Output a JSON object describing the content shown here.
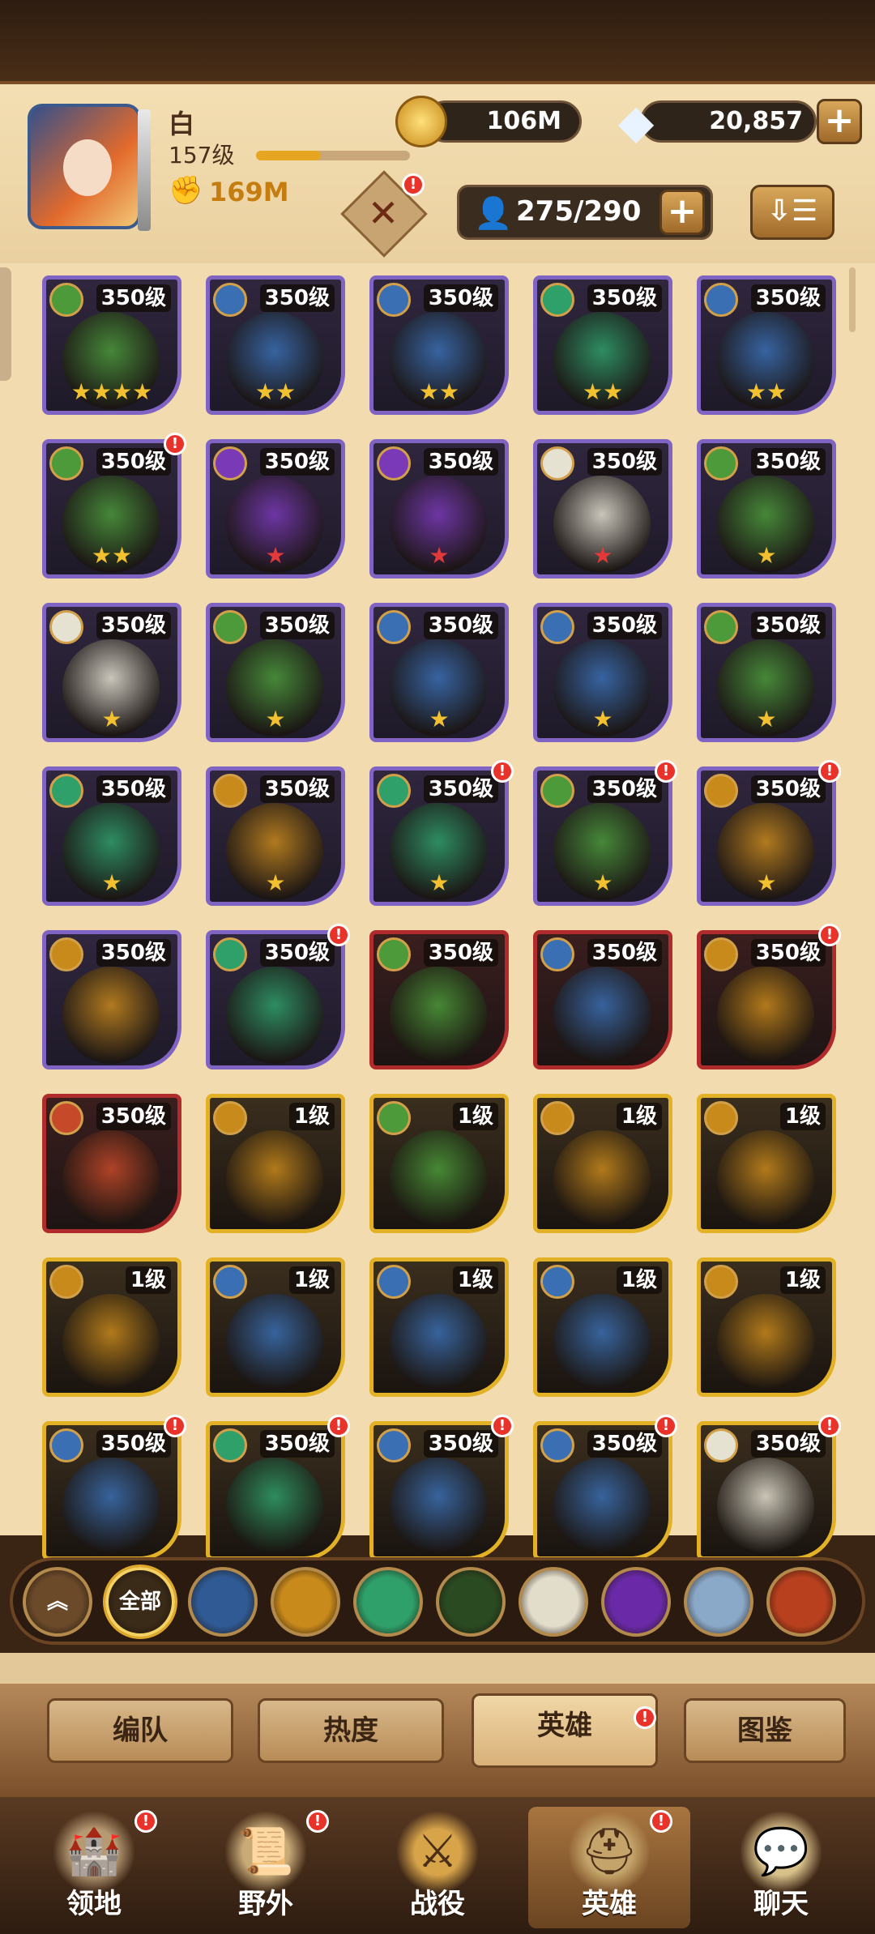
{
  "colors": {
    "accent": "#e2b126",
    "alert": "#e8322a"
  },
  "player": {
    "name": "白",
    "level": "157级",
    "xp_fraction": 0.42,
    "power": "169M",
    "power_icon": "fist-icon"
  },
  "resources": {
    "gold": "106M",
    "gold_icon": "gold-coin-icon",
    "diamonds": "20,857",
    "diamond_icon": "diamond-icon",
    "plus": "+"
  },
  "summon": {
    "icon": "summon-banner-icon",
    "badge": "!"
  },
  "hero_capacity": {
    "icon": "user-icon",
    "value": "275/290",
    "plus": "+"
  },
  "sort_button": {
    "glyph": "⇩☰"
  },
  "heroes": [
    {
      "level": "350级",
      "frame": "purple",
      "faction": "forest",
      "stars": "★★★★",
      "star_color": "gold",
      "alert": false
    },
    {
      "level": "350级",
      "frame": "purple",
      "faction": "lightbearer",
      "stars": "★★",
      "star_color": "gold",
      "alert": false
    },
    {
      "level": "350级",
      "frame": "purple",
      "faction": "lightbearer",
      "stars": "★★",
      "star_color": "gold",
      "alert": false
    },
    {
      "level": "350级",
      "frame": "purple",
      "faction": "wilder",
      "stars": "★★",
      "star_color": "gold",
      "alert": false
    },
    {
      "level": "350级",
      "frame": "purple",
      "faction": "lightbearer",
      "stars": "★★",
      "star_color": "gold",
      "alert": false
    },
    {
      "level": "350级",
      "frame": "purple",
      "faction": "forest",
      "stars": "★★",
      "star_color": "gold",
      "alert": true
    },
    {
      "level": "350级",
      "frame": "purple",
      "faction": "hypogean",
      "stars": "★",
      "star_color": "red",
      "alert": false
    },
    {
      "level": "350级",
      "frame": "purple",
      "faction": "hypogean",
      "stars": "★",
      "star_color": "red",
      "alert": false
    },
    {
      "level": "350级",
      "frame": "purple",
      "faction": "celestial",
      "stars": "★",
      "star_color": "red",
      "alert": false
    },
    {
      "level": "350级",
      "frame": "purple",
      "faction": "forest",
      "stars": "★",
      "star_color": "gold",
      "alert": false
    },
    {
      "level": "350级",
      "frame": "purple",
      "faction": "celestial",
      "stars": "★",
      "star_color": "gold",
      "alert": false
    },
    {
      "level": "350级",
      "frame": "purple",
      "faction": "forest",
      "stars": "★",
      "star_color": "gold",
      "alert": false
    },
    {
      "level": "350级",
      "frame": "purple",
      "faction": "lightbearer",
      "stars": "★",
      "star_color": "gold",
      "alert": false
    },
    {
      "level": "350级",
      "frame": "purple",
      "faction": "lightbearer",
      "stars": "★",
      "star_color": "gold",
      "alert": false
    },
    {
      "level": "350级",
      "frame": "purple",
      "faction": "forest",
      "stars": "★",
      "star_color": "gold",
      "alert": false
    },
    {
      "level": "350级",
      "frame": "purple",
      "faction": "wilder",
      "stars": "★",
      "star_color": "gold",
      "alert": false
    },
    {
      "level": "350级",
      "frame": "purple",
      "faction": "mauler",
      "stars": "★",
      "star_color": "gold",
      "alert": false
    },
    {
      "level": "350级",
      "frame": "purple",
      "faction": "wilder",
      "stars": "★",
      "star_color": "gold",
      "alert": true
    },
    {
      "level": "350级",
      "frame": "purple",
      "faction": "forest",
      "stars": "★",
      "star_color": "gold",
      "alert": true
    },
    {
      "level": "350级",
      "frame": "purple",
      "faction": "mauler",
      "stars": "★",
      "star_color": "gold",
      "alert": true
    },
    {
      "level": "350级",
      "frame": "purple",
      "faction": "mauler",
      "stars": "",
      "star_color": "gold",
      "alert": false
    },
    {
      "level": "350级",
      "frame": "purple",
      "faction": "wilder",
      "stars": "",
      "star_color": "gold",
      "alert": true
    },
    {
      "level": "350级",
      "frame": "red",
      "faction": "forest",
      "stars": "",
      "star_color": "gold",
      "alert": false
    },
    {
      "level": "350级",
      "frame": "red",
      "faction": "lightbearer",
      "stars": "",
      "star_color": "gold",
      "alert": false
    },
    {
      "level": "350级",
      "frame": "red",
      "faction": "mauler",
      "stars": "",
      "star_color": "gold",
      "alert": true
    },
    {
      "level": "350级",
      "frame": "red",
      "faction": "dimensional",
      "stars": "",
      "star_color": "gold",
      "alert": false
    },
    {
      "level": "1级",
      "frame": "gold",
      "faction": "mauler",
      "stars": "",
      "star_color": "gold",
      "alert": false
    },
    {
      "level": "1级",
      "frame": "gold",
      "faction": "forest",
      "stars": "",
      "star_color": "gold",
      "alert": false
    },
    {
      "level": "1级",
      "frame": "gold",
      "faction": "mauler",
      "stars": "",
      "star_color": "gold",
      "alert": false
    },
    {
      "level": "1级",
      "frame": "gold",
      "faction": "mauler",
      "stars": "",
      "star_color": "gold",
      "alert": false
    },
    {
      "level": "1级",
      "frame": "gold",
      "faction": "mauler",
      "stars": "",
      "star_color": "gold",
      "alert": false
    },
    {
      "level": "1级",
      "frame": "gold",
      "faction": "lightbearer",
      "stars": "",
      "star_color": "gold",
      "alert": false
    },
    {
      "level": "1级",
      "frame": "gold",
      "faction": "lightbearer",
      "stars": "",
      "star_color": "gold",
      "alert": false
    },
    {
      "level": "1级",
      "frame": "gold",
      "faction": "lightbearer",
      "stars": "",
      "star_color": "gold",
      "alert": false
    },
    {
      "level": "1级",
      "frame": "gold",
      "faction": "mauler",
      "stars": "",
      "star_color": "gold",
      "alert": false
    },
    {
      "level": "350级",
      "frame": "gold",
      "faction": "lightbearer",
      "stars": "",
      "star_color": "gold",
      "alert": true
    },
    {
      "level": "350级",
      "frame": "gold",
      "faction": "wilder",
      "stars": "",
      "star_color": "gold",
      "alert": true
    },
    {
      "level": "350级",
      "frame": "gold",
      "faction": "lightbearer",
      "stars": "",
      "star_color": "gold",
      "alert": true
    },
    {
      "level": "350级",
      "frame": "gold",
      "faction": "lightbearer",
      "stars": "",
      "star_color": "gold",
      "alert": true
    },
    {
      "level": "350级",
      "frame": "gold",
      "faction": "celestial",
      "stars": "",
      "star_color": "gold",
      "alert": true
    }
  ],
  "faction_colors": {
    "forest": "#4c9a3a",
    "lightbearer": "#3a6fb4",
    "wilder": "#2fa06a",
    "mauler": "#c98a1c",
    "hypogean": "#7a3ab8",
    "celestial": "#e6e2d2",
    "dimensional": "#c64a2a"
  },
  "filters": [
    {
      "name": "collapse",
      "label": "",
      "icon": "double-chevron-up-icon",
      "bg": "#6b4a2a"
    },
    {
      "name": "all",
      "label": "全部",
      "icon": "",
      "bg": "#3a2a18",
      "selected": true
    },
    {
      "name": "lightbearer",
      "label": "",
      "icon": "lightbearer-faction-icon",
      "bg": "#2f5a94"
    },
    {
      "name": "mauler",
      "label": "",
      "icon": "mauler-faction-icon",
      "bg": "#c98a1c"
    },
    {
      "name": "wilder",
      "label": "",
      "icon": "wilder-faction-icon",
      "bg": "#2fa06a"
    },
    {
      "name": "graveborn",
      "label": "",
      "icon": "graveborn-faction-icon",
      "bg": "#2a4a22"
    },
    {
      "name": "celestial",
      "label": "",
      "icon": "celestial-faction-icon",
      "bg": "#e2dccb"
    },
    {
      "name": "hypogean",
      "label": "",
      "icon": "hypogean-faction-icon",
      "bg": "#6a2aa8"
    },
    {
      "name": "dimensional",
      "label": "",
      "icon": "dimensional-faction-icon",
      "bg": "#8aa8c8"
    },
    {
      "name": "draconis",
      "label": "",
      "icon": "draconis-faction-icon",
      "bg": "#b8401e"
    }
  ],
  "subtabs": [
    {
      "label": "编队",
      "selected": false,
      "alert": false
    },
    {
      "label": "热度",
      "selected": false,
      "alert": false
    },
    {
      "label": "英雄",
      "selected": true,
      "alert": true
    },
    {
      "label": "图鉴",
      "selected": false,
      "alert": false
    }
  ],
  "bottom_nav": [
    {
      "label": "领地",
      "icon": "castle-icon",
      "selected": false,
      "alert": true
    },
    {
      "label": "野外",
      "icon": "map-scroll-icon",
      "selected": false,
      "alert": true
    },
    {
      "label": "战役",
      "icon": "sword-emblem-icon",
      "selected": false,
      "alert": false
    },
    {
      "label": "英雄",
      "icon": "helmet-icon",
      "selected": true,
      "alert": true
    },
    {
      "label": "聊天",
      "icon": "chat-bubble-icon",
      "selected": false,
      "alert": false
    }
  ]
}
